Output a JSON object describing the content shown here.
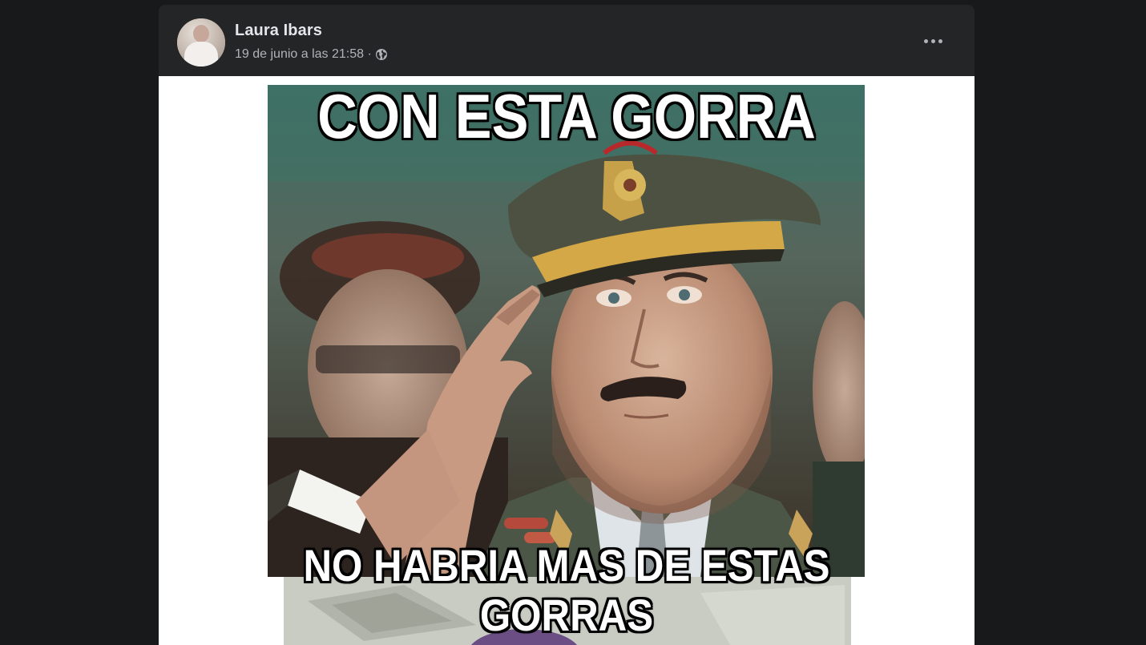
{
  "post": {
    "author_name": "Laura Ibars",
    "timestamp": "19 de junio a las 21:58 ·",
    "audience_icon": "globe-icon",
    "more_options_icon": "more-horizontal-icon"
  },
  "meme": {
    "top_text": "CON ESTA GORRA",
    "bottom_text_line1": "NO HABRIA MAS DE ESTAS",
    "bottom_text_line2": "GORRAS"
  },
  "colors": {
    "page_background": "#18191a",
    "card_background": "#242526",
    "primary_text": "#e4e6eb",
    "secondary_text": "#b0b3b8",
    "media_background": "#ffffff"
  }
}
